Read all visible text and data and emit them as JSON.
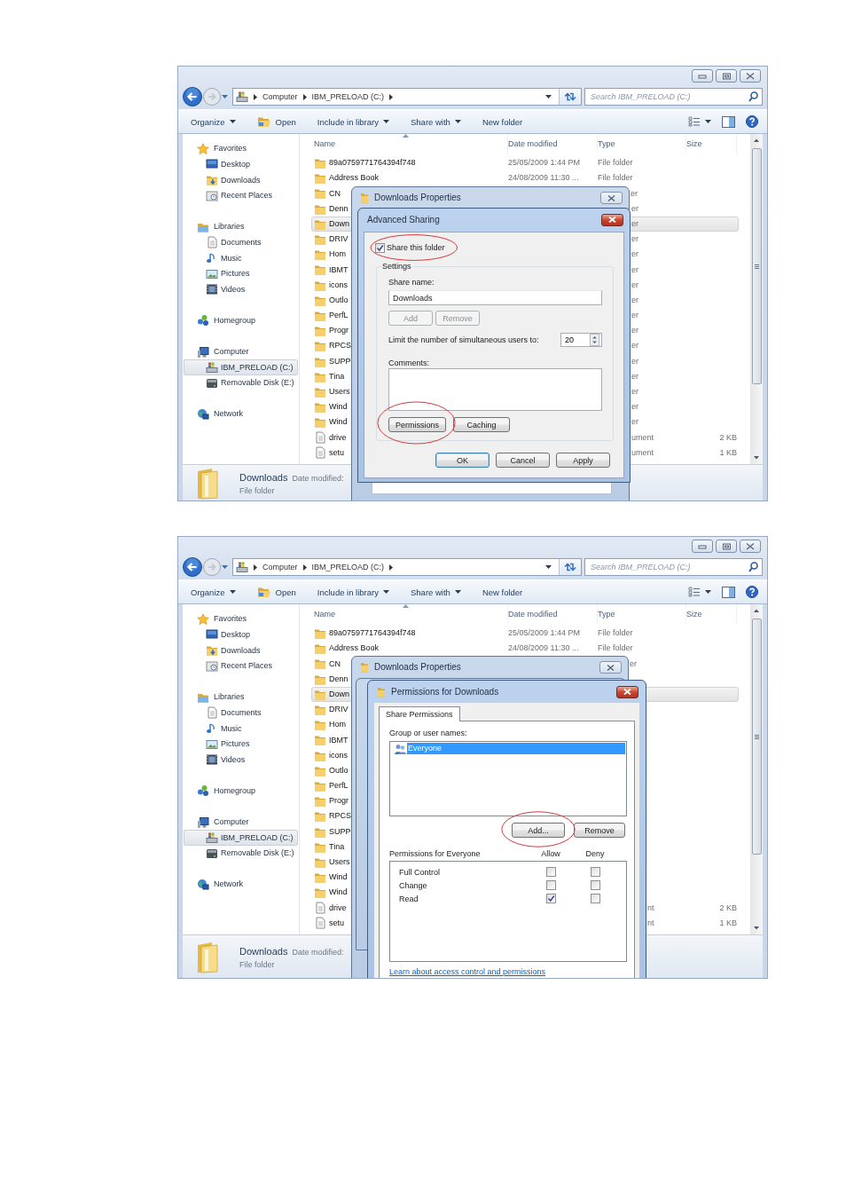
{
  "screenshots": [
    {
      "address": {
        "crumbs": [
          "Computer",
          "IBM_PRELOAD (C:)"
        ]
      },
      "search": {
        "placeholder": "Search IBM_PRELOAD (C:)"
      },
      "toolbar": [
        {
          "label": "Organize",
          "kind": "menu"
        },
        {
          "label": "Open",
          "kind": "open"
        },
        {
          "label": "Include in library",
          "kind": "menu"
        },
        {
          "label": "Share with",
          "kind": "menu"
        },
        {
          "label": "New folder",
          "kind": "plain"
        }
      ],
      "nav": [
        {
          "label": "Favorites",
          "selected": false,
          "children": [
            {
              "label": "Desktop",
              "selected": false
            },
            {
              "label": "Downloads",
              "selected": false
            },
            {
              "label": "Recent Places",
              "selected": false
            }
          ]
        },
        {
          "label": "Libraries",
          "selected": false,
          "children": [
            {
              "label": "Documents",
              "selected": false
            },
            {
              "label": "Music",
              "selected": false
            },
            {
              "label": "Pictures",
              "selected": false
            },
            {
              "label": "Videos",
              "selected": false
            }
          ]
        },
        {
          "label": "Homegroup",
          "selected": false
        },
        {
          "label": "Computer",
          "selected": false,
          "children": [
            {
              "label": "IBM_PRELOAD (C:)",
              "selected": true
            },
            {
              "label": "Removable Disk (E:)",
              "selected": false
            }
          ]
        },
        {
          "label": "Network",
          "selected": false
        }
      ],
      "file_list": {
        "columns": [
          "Name",
          "Date modified",
          "Type",
          "Size"
        ],
        "rows": [
          {
            "name": "89a0759771764394f748",
            "date": "25/05/2009 1:44 PM",
            "type": "File folder",
            "kind": "folder",
            "selected": false
          },
          {
            "name": "Address Book",
            "date": "24/08/2009 11:30 ...",
            "type": "File folder",
            "kind": "folder",
            "selected": false
          },
          {
            "name": "CN",
            "type": "er",
            "kind": "folder",
            "selected": false
          },
          {
            "name": "Denn",
            "type": "er",
            "kind": "folder",
            "selected": false
          },
          {
            "name": "Down",
            "type": "er",
            "kind": "folder",
            "selected": true
          },
          {
            "name": "DRIV",
            "type": "er",
            "kind": "folder",
            "selected": false
          },
          {
            "name": "Hom",
            "type": "er",
            "kind": "folder",
            "selected": false
          },
          {
            "name": "IBMT",
            "type": "er",
            "kind": "folder",
            "selected": false
          },
          {
            "name": "icons",
            "type": "er",
            "kind": "folder",
            "selected": false
          },
          {
            "name": "Outlo",
            "type": "er",
            "kind": "folder",
            "selected": false
          },
          {
            "name": "PerfL",
            "type": "er",
            "kind": "folder",
            "selected": false
          },
          {
            "name": "Progr",
            "type": "er",
            "kind": "folder",
            "selected": false
          },
          {
            "name": "RPCS",
            "type": "er",
            "kind": "folder",
            "selected": false
          },
          {
            "name": "SUPP",
            "type": "er",
            "kind": "folder",
            "selected": false
          },
          {
            "name": "Tina",
            "type": "er",
            "kind": "folder",
            "selected": false
          },
          {
            "name": "Users",
            "type": "er",
            "kind": "folder",
            "selected": false
          },
          {
            "name": "Wind",
            "type": "er",
            "kind": "folder",
            "selected": false
          },
          {
            "name": "Wind",
            "type": "er",
            "kind": "folder",
            "selected": false
          },
          {
            "name": "drive",
            "type": "ument",
            "size": "2 KB",
            "kind": "file",
            "selected": false
          },
          {
            "name": "setu",
            "type": "ument",
            "size": "1 KB",
            "kind": "file",
            "selected": false
          }
        ]
      },
      "details": {
        "name": "Downloads",
        "label": "Date modified:",
        "type": "File folder"
      },
      "dialogs": [
        {
          "kind": "properties",
          "title": "Downloads Properties"
        },
        {
          "kind": "advanced_sharing",
          "title": "Advanced Sharing",
          "share": {
            "label": "Share this folder",
            "checked": true,
            "circled": true
          },
          "settings_label": "Settings",
          "share_name_label": "Share name:",
          "share_name": "Downloads",
          "name_buttons": [
            {
              "label": "Add",
              "disabled": true
            },
            {
              "label": "Remove",
              "disabled": true
            }
          ],
          "limit_label": "Limit the number of simultaneous users to:",
          "limit_value": "20",
          "comments_label": "Comments:",
          "buttons": [
            {
              "label": "Permissions",
              "circled": true
            },
            {
              "label": "Caching",
              "circled": false
            }
          ],
          "footer_buttons": [
            {
              "label": "OK",
              "default": true
            },
            {
              "label": "Cancel",
              "default": false
            },
            {
              "label": "Apply",
              "default": false
            }
          ]
        }
      ]
    },
    {
      "address": {
        "crumbs": [
          "Computer",
          "IBM_PRELOAD (C:)"
        ]
      },
      "search": {
        "placeholder": "Search IBM_PRELOAD (C:)"
      },
      "toolbar": [
        {
          "label": "Organize",
          "kind": "menu"
        },
        {
          "label": "Open",
          "kind": "open"
        },
        {
          "label": "Include in library",
          "kind": "menu"
        },
        {
          "label": "Share with",
          "kind": "menu"
        },
        {
          "label": "New folder",
          "kind": "plain"
        }
      ],
      "nav": [
        {
          "label": "Favorites",
          "selected": false,
          "children": [
            {
              "label": "Desktop",
              "selected": false
            },
            {
              "label": "Downloads",
              "selected": false
            },
            {
              "label": "Recent Places",
              "selected": false
            }
          ]
        },
        {
          "label": "Libraries",
          "selected": false,
          "children": [
            {
              "label": "Documents",
              "selected": false
            },
            {
              "label": "Music",
              "selected": false
            },
            {
              "label": "Pictures",
              "selected": false
            },
            {
              "label": "Videos",
              "selected": false
            }
          ]
        },
        {
          "label": "Homegroup",
          "selected": false
        },
        {
          "label": "Computer",
          "selected": false,
          "children": [
            {
              "label": "IBM_PRELOAD (C:)",
              "selected": true
            },
            {
              "label": "Removable Disk (E:)",
              "selected": false
            }
          ]
        },
        {
          "label": "Network",
          "selected": false
        }
      ],
      "file_list": {
        "columns": [
          "Name",
          "Date modified",
          "Type",
          "Size"
        ],
        "rows": [
          {
            "name": "89a0759771764394f748",
            "date": "25/05/2009 1:44 PM",
            "type": "File folder",
            "kind": "folder",
            "selected": false
          },
          {
            "name": "Address Book",
            "date": "24/08/2009 11:30 ...",
            "type": "File folder",
            "kind": "folder",
            "selected": false
          },
          {
            "name": "CN",
            "type": "er",
            "kind": "folder",
            "selected": false
          },
          {
            "name": "Denn",
            "kind": "folder",
            "selected": false
          },
          {
            "name": "Down",
            "kind": "folder",
            "selected": true
          },
          {
            "name": "DRIV",
            "kind": "folder",
            "selected": false
          },
          {
            "name": "Hom",
            "kind": "folder",
            "selected": false
          },
          {
            "name": "IBMT",
            "kind": "folder",
            "selected": false
          },
          {
            "name": "icons",
            "kind": "folder",
            "selected": false
          },
          {
            "name": "Outlo",
            "kind": "folder",
            "selected": false
          },
          {
            "name": "PerfL",
            "kind": "folder",
            "selected": false
          },
          {
            "name": "Progr",
            "kind": "folder",
            "selected": false
          },
          {
            "name": "RPCS",
            "kind": "folder",
            "selected": false
          },
          {
            "name": "SUPP",
            "kind": "folder",
            "selected": false
          },
          {
            "name": "Tina",
            "kind": "folder",
            "selected": false
          },
          {
            "name": "Users",
            "kind": "folder",
            "selected": false
          },
          {
            "name": "Wind",
            "kind": "folder",
            "selected": false
          },
          {
            "name": "Wind",
            "kind": "folder",
            "selected": false
          },
          {
            "name": "drive",
            "type": "nt",
            "size": "2 KB",
            "kind": "file",
            "selected": false
          },
          {
            "name": "setu",
            "type": "nt",
            "size": "1 KB",
            "kind": "file",
            "selected": false
          }
        ]
      },
      "details": {
        "name": "Downloads",
        "label": "Date modified:",
        "type": "File folder"
      },
      "dialogs": [
        {
          "kind": "properties",
          "title": "Downloads Properties"
        },
        {
          "kind": "window_frame"
        },
        {
          "kind": "permissions",
          "title": "Permissions for Downloads",
          "tabs": [
            {
              "label": "Share Permissions",
              "selected": true
            }
          ],
          "group_label": "Group or user names:",
          "principals": [
            {
              "label": "Everyone",
              "selected": true
            }
          ],
          "buttons": [
            {
              "label": "Add...",
              "circled": true
            },
            {
              "label": "Remove",
              "circled": false
            }
          ],
          "permissions_label": "Permissions for Everyone",
          "columns": [
            "Allow",
            "Deny"
          ],
          "permissions": [
            {
              "label": "Full Control",
              "allow": false,
              "deny": false
            },
            {
              "label": "Change",
              "allow": false,
              "deny": false
            },
            {
              "label": "Read",
              "allow": true,
              "deny": false
            }
          ],
          "link": "Learn about access control and permissions"
        }
      ]
    }
  ]
}
